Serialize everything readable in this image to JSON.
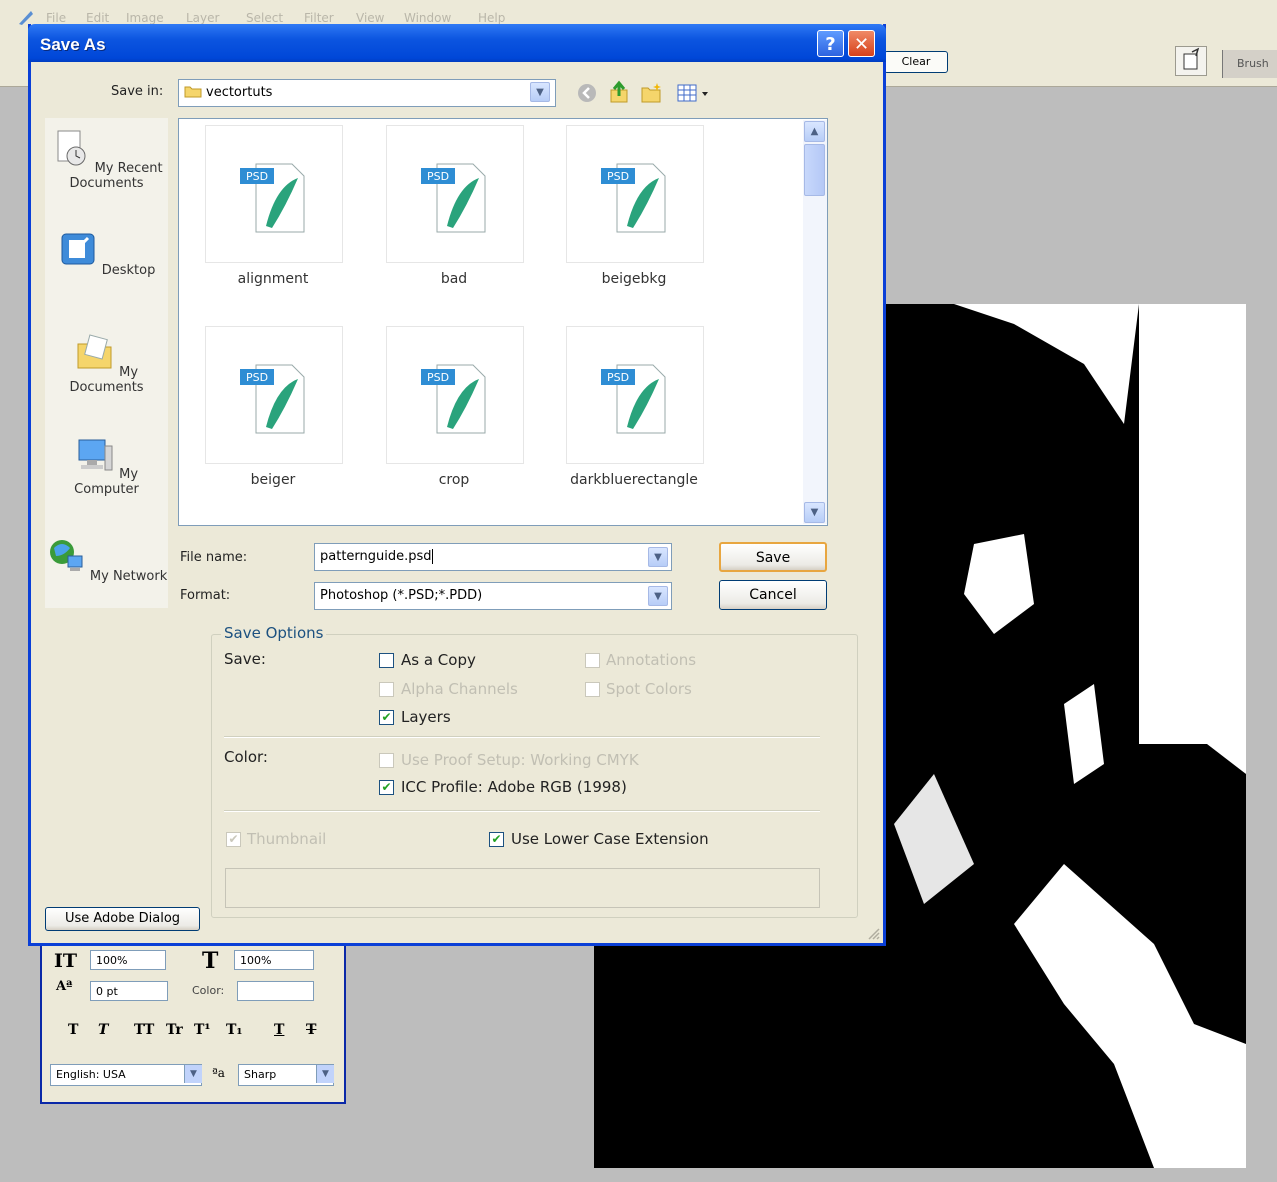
{
  "app": {
    "menu": [
      "File",
      "Edit",
      "Image",
      "Layer",
      "Select",
      "Filter",
      "View",
      "Window",
      "Help"
    ],
    "options_bar": {
      "clear_label": "Clear",
      "brush_tab_label": "Brush"
    }
  },
  "dialog": {
    "title": "Save As",
    "help_label": "?",
    "close_label": "✕",
    "save_in_label": "Save in:",
    "save_in_value": "vectortuts",
    "places": [
      {
        "label": "My Recent Documents",
        "icon": "recent-documents-icon"
      },
      {
        "label": "Desktop",
        "icon": "desktop-icon"
      },
      {
        "label": "My Documents",
        "icon": "my-documents-icon"
      },
      {
        "label": "My Computer",
        "icon": "my-computer-icon"
      },
      {
        "label": "My Network",
        "icon": "my-network-icon"
      }
    ],
    "files": [
      {
        "name": "alignment",
        "badge": "PSD"
      },
      {
        "name": "bad",
        "badge": "PSD"
      },
      {
        "name": "beigebkg",
        "badge": "PSD"
      },
      {
        "name": "beiger",
        "badge": "PSD"
      },
      {
        "name": "crop",
        "badge": "PSD"
      },
      {
        "name": "darkbluerectangle",
        "badge": "PSD"
      }
    ],
    "file_name_label": "File name:",
    "file_name_value": "patternguide.psd",
    "format_label": "Format:",
    "format_value": "Photoshop (*.PSD;*.PDD)",
    "save_button": "Save",
    "cancel_button": "Cancel",
    "save_options": {
      "legend": "Save Options",
      "save_label": "Save:",
      "as_a_copy": {
        "label": "As a Copy",
        "checked": false,
        "enabled": true
      },
      "annotations": {
        "label": "Annotations",
        "checked": false,
        "enabled": false
      },
      "alpha_channels": {
        "label": "Alpha Channels",
        "checked": false,
        "enabled": false
      },
      "spot_colors": {
        "label": "Spot Colors",
        "checked": false,
        "enabled": false
      },
      "layers": {
        "label": "Layers",
        "checked": true,
        "enabled": true
      },
      "color_label": "Color:",
      "use_proof_setup": {
        "label": "Use Proof Setup:  Working CMYK",
        "checked": false,
        "enabled": false
      },
      "icc_profile": {
        "label": "ICC Profile:  Adobe RGB (1998)",
        "checked": true,
        "enabled": true
      },
      "thumbnail": {
        "label": "Thumbnail",
        "checked": true,
        "enabled": false
      },
      "lower_case_ext": {
        "label": "Use Lower Case Extension",
        "checked": true,
        "enabled": true
      }
    },
    "use_adobe_dialog": "Use Adobe Dialog"
  },
  "character_panel": {
    "vertical_scale": "100%",
    "horizontal_scale": "100%",
    "baseline_shift": "0 pt",
    "color_label": "Color:",
    "style_buttons": [
      "T",
      "T",
      "TT",
      "Tr",
      "T¹",
      "T₁",
      "T",
      "T"
    ],
    "language": "English: USA",
    "antialias_glyph": "ªa",
    "antialias": "Sharp"
  },
  "colors": {
    "xp_blue": "#0a3fd7",
    "dialog_bg": "#ece9d8",
    "legend_blue": "#1c5180",
    "check_green": "#21a121"
  }
}
